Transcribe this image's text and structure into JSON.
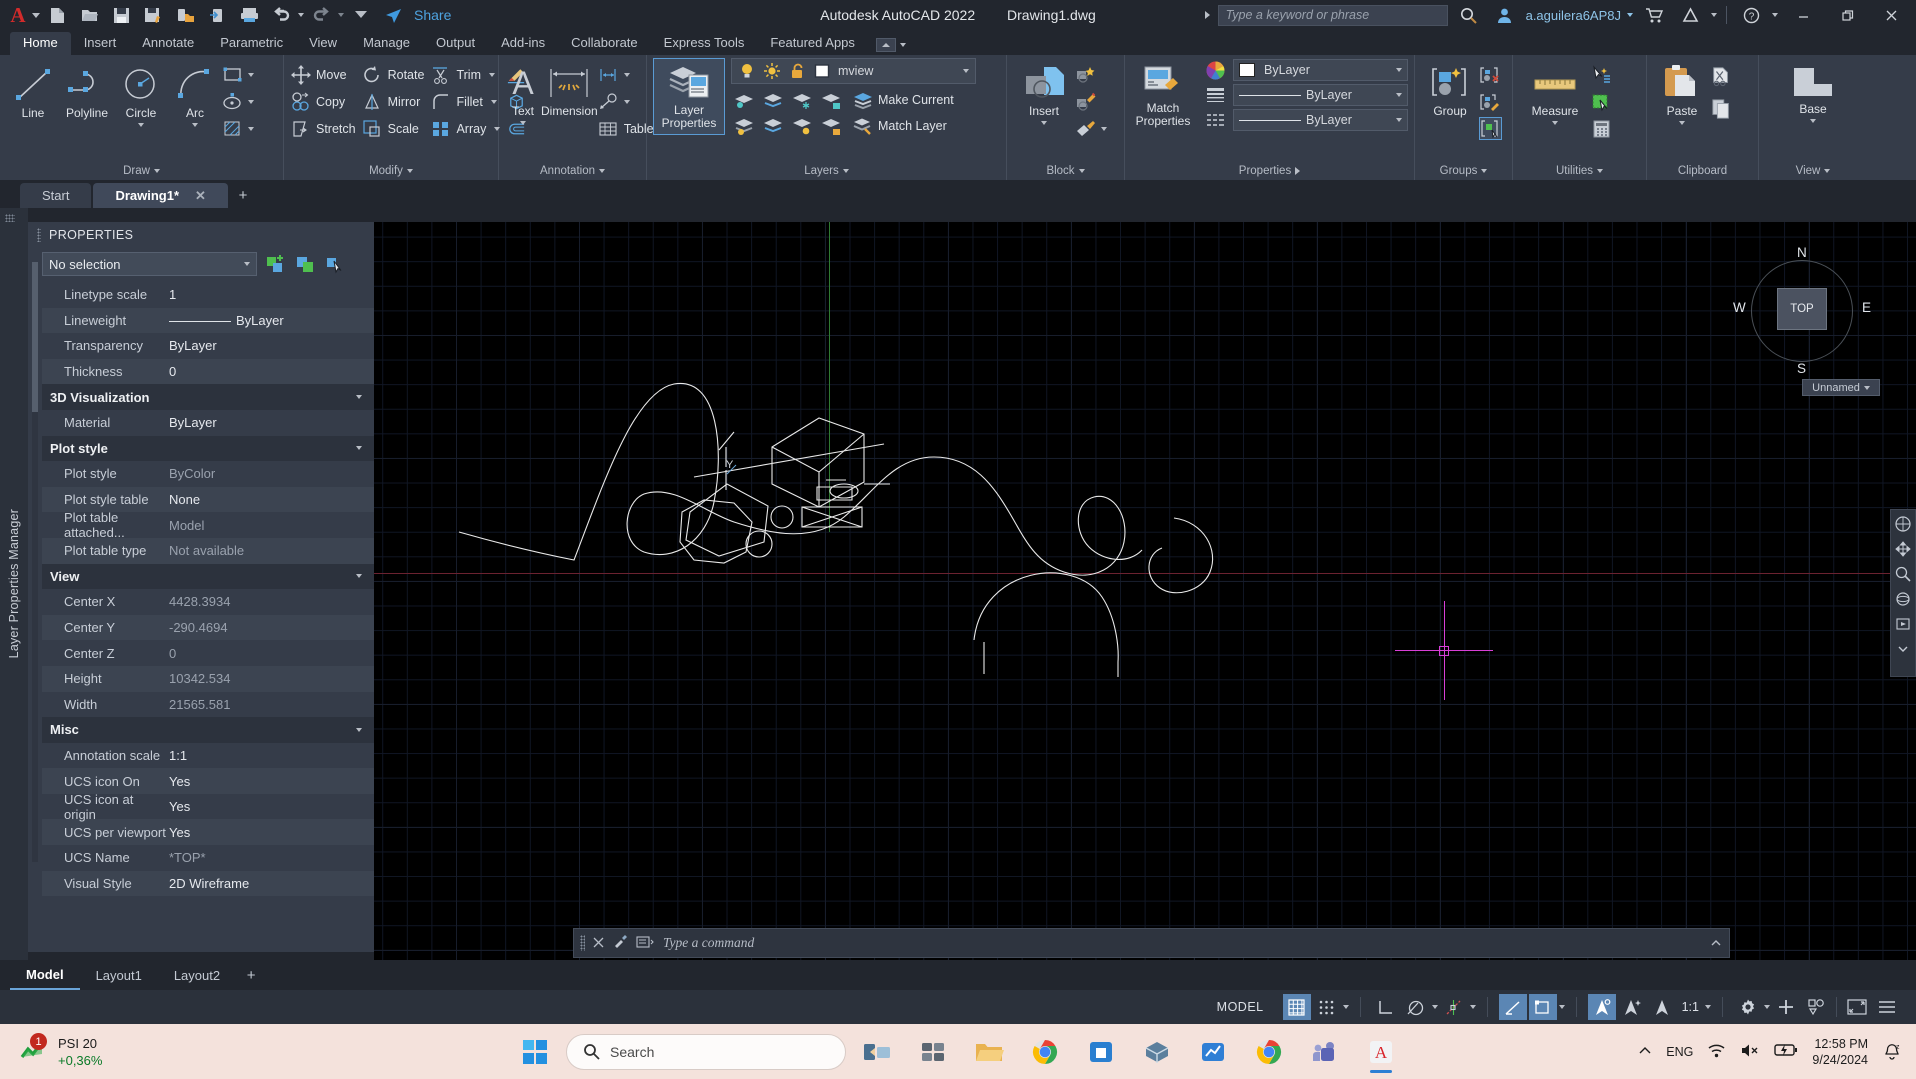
{
  "titlebar": {
    "app_icon": "autocad-a-icon",
    "quick_access": [
      {
        "name": "new-file-icon",
        "label": "New"
      },
      {
        "name": "open-folder-icon",
        "label": "Open"
      },
      {
        "name": "save-icon",
        "label": "Save"
      },
      {
        "name": "save-as-icon",
        "label": "Save As"
      },
      {
        "name": "save-to-web-icon",
        "label": "Save to Web & Mobile"
      },
      {
        "name": "open-from-web-icon",
        "label": "Open from Web & Mobile"
      },
      {
        "name": "plot-icon",
        "label": "Plot"
      },
      {
        "name": "undo-icon",
        "label": "Undo"
      },
      {
        "name": "redo-icon",
        "label": "Redo"
      }
    ],
    "share_label": "Share",
    "product": "Autodesk AutoCAD 2022",
    "document": "Drawing1.dwg",
    "search_placeholder": "Type a keyword or phrase",
    "account": "a.aguilera6AP8J",
    "window_controls": [
      "minimize",
      "restore",
      "close"
    ]
  },
  "ribbon_tabs": [
    {
      "label": "Home",
      "active": true
    },
    {
      "label": "Insert",
      "active": false
    },
    {
      "label": "Annotate",
      "active": false
    },
    {
      "label": "Parametric",
      "active": false
    },
    {
      "label": "View",
      "active": false
    },
    {
      "label": "Manage",
      "active": false
    },
    {
      "label": "Output",
      "active": false
    },
    {
      "label": "Add-ins",
      "active": false
    },
    {
      "label": "Collaborate",
      "active": false
    },
    {
      "label": "Express Tools",
      "active": false
    },
    {
      "label": "Featured Apps",
      "active": false
    }
  ],
  "ribbon": {
    "draw": {
      "title": "Draw",
      "big": [
        {
          "label": "Line",
          "icon": "line-icon"
        },
        {
          "label": "Polyline",
          "icon": "polyline-icon"
        },
        {
          "label": "Circle",
          "icon": "circle-icon",
          "has_dropdown": true
        },
        {
          "label": "Arc",
          "icon": "arc-icon",
          "has_dropdown": true
        }
      ],
      "small": [
        {
          "icon": "rectangle-icon",
          "label": "Rectangle"
        },
        {
          "icon": "ellipse-icon",
          "label": "Ellipse"
        },
        {
          "icon": "hatch-icon",
          "label": "Hatch"
        }
      ]
    },
    "modify": {
      "title": "Modify",
      "items": [
        {
          "label": "Move",
          "icon": "move-icon"
        },
        {
          "label": "Rotate",
          "icon": "rotate-icon"
        },
        {
          "label": "Trim",
          "icon": "trim-icon",
          "has_dropdown": true
        },
        {
          "label": "Copy",
          "icon": "copy-icon"
        },
        {
          "label": "Mirror",
          "icon": "mirror-icon"
        },
        {
          "label": "Fillet",
          "icon": "fillet-icon",
          "has_dropdown": true
        },
        {
          "label": "Stretch",
          "icon": "stretch-icon"
        },
        {
          "label": "Scale",
          "icon": "scale-icon"
        },
        {
          "label": "Array",
          "icon": "array-icon",
          "has_dropdown": true
        }
      ],
      "extra_icons": [
        "erase-icon",
        "explode-icon",
        "offset-icon"
      ]
    },
    "annotation": {
      "title": "Annotation",
      "big": [
        {
          "label": "Text",
          "icon": "text-icon",
          "has_dropdown": true
        },
        {
          "label": "Dimension",
          "icon": "dimension-icon"
        }
      ],
      "small": [
        {
          "icon": "linear-dim-icon",
          "label": "Linear"
        },
        {
          "icon": "leader-icon",
          "label": "Leader"
        },
        {
          "icon": "table-icon",
          "label": "Table"
        }
      ]
    },
    "layers": {
      "title": "Layers",
      "big_label": "Layer\nProperties",
      "big_label_line1": "Layer",
      "big_label_line2": "Properties",
      "current_layer": "mview",
      "make_current": "Make Current",
      "match_layer": "Match Layer",
      "state_icons": [
        "lightbulb-on-icon",
        "sun-freeze-icon",
        "unlock-icon",
        "layer-color-swatch"
      ]
    },
    "block": {
      "title": "Block",
      "big_label": "Insert",
      "small": [
        "create-block-icon",
        "edit-block-icon",
        "edit-attribute-icon"
      ]
    },
    "properties": {
      "title": "Properties",
      "match_label_line1": "Match",
      "match_label_line2": "Properties",
      "color": "ByLayer",
      "linetype": "ByLayer",
      "lineweight": "ByLayer"
    },
    "groups": {
      "title": "Groups",
      "big_label": "Group",
      "small": [
        "ungroup-icon",
        "edit-group-icon",
        "group-selection-icon"
      ]
    },
    "utilities": {
      "title": "Utilities",
      "big_label": "Measure",
      "small": [
        "quick-select-icon",
        "select-all-icon",
        "calculator-icon"
      ]
    },
    "clipboard": {
      "title": "Clipboard",
      "big_label": "Paste",
      "small": [
        "cut-icon",
        "copy-clip-icon"
      ]
    },
    "view": {
      "title": "View",
      "big_label": "Base"
    }
  },
  "file_tabs": [
    {
      "label": "Start",
      "active": false,
      "closable": false
    },
    {
      "label": "Drawing1*",
      "active": true,
      "closable": true
    }
  ],
  "file_tab_add": "+",
  "left_rail": {
    "label": "Layer Properties Manager"
  },
  "properties_palette": {
    "title": "PROPERTIES",
    "selection": "No selection",
    "toolbar_icons": [
      "quick-select-icon",
      "select-objects-icon",
      "pickadd-icon"
    ],
    "groups": [
      {
        "name": "",
        "is_header": false,
        "rows": [
          {
            "key": "Linetype scale",
            "value": "1",
            "dim": false
          },
          {
            "key": "Lineweight",
            "value": "ByLayer",
            "dim": false,
            "has_line": true
          },
          {
            "key": "Transparency",
            "value": "ByLayer",
            "dim": false
          },
          {
            "key": "Thickness",
            "value": "0",
            "dim": false
          }
        ]
      },
      {
        "name": "3D Visualization",
        "is_header": true,
        "rows": [
          {
            "key": "Material",
            "value": "ByLayer",
            "dim": false
          }
        ]
      },
      {
        "name": "Plot style",
        "is_header": true,
        "rows": [
          {
            "key": "Plot style",
            "value": "ByColor",
            "dim": true
          },
          {
            "key": "Plot style table",
            "value": "None",
            "dim": false
          },
          {
            "key": "Plot table attached...",
            "value": "Model",
            "dim": true
          },
          {
            "key": "Plot table type",
            "value": "Not available",
            "dim": true
          }
        ]
      },
      {
        "name": "View",
        "is_header": true,
        "rows": [
          {
            "key": "Center X",
            "value": "4428.3934",
            "dim": true
          },
          {
            "key": "Center Y",
            "value": "-290.4694",
            "dim": true
          },
          {
            "key": "Center Z",
            "value": "0",
            "dim": true
          },
          {
            "key": "Height",
            "value": "10342.534",
            "dim": true
          },
          {
            "key": "Width",
            "value": "21565.581",
            "dim": true
          }
        ]
      },
      {
        "name": "Misc",
        "is_header": true,
        "rows": [
          {
            "key": "Annotation scale",
            "value": "1:1",
            "dim": false
          },
          {
            "key": "UCS icon On",
            "value": "Yes",
            "dim": false
          },
          {
            "key": "UCS icon at origin",
            "value": "Yes",
            "dim": false
          },
          {
            "key": "UCS per viewport",
            "value": "Yes",
            "dim": false
          },
          {
            "key": "UCS Name",
            "value": "*TOP*",
            "dim": true
          },
          {
            "key": "Visual Style",
            "value": "2D Wireframe",
            "dim": false
          }
        ]
      }
    ]
  },
  "canvas": {
    "viewcube": {
      "top_label": "TOP",
      "north": "N",
      "south": "S",
      "east": "E",
      "west": "W"
    },
    "ucs_label": "Unnamed",
    "ucs_axis_y": "Y",
    "navbar_icons": [
      "pan-icon",
      "zoom-icon",
      "orbit-icon",
      "showmotion-icon",
      "steering-wheel-icon"
    ],
    "window_controls": [
      "minimize",
      "maximize",
      "close"
    ]
  },
  "command_line": {
    "placeholder": "Type a command",
    "icons": [
      "command-grip",
      "close-icon",
      "customize-icon",
      "command-history-icon"
    ]
  },
  "layout_tabs": [
    {
      "label": "Model",
      "active": true
    },
    {
      "label": "Layout1",
      "active": false
    },
    {
      "label": "Layout2",
      "active": false
    }
  ],
  "layout_tab_add": "+",
  "status_bar": {
    "space_label": "MODEL",
    "buttons": [
      {
        "name": "grid-display-toggle",
        "icon": "grid-icon",
        "on": true
      },
      {
        "name": "snap-mode-toggle",
        "icon": "snap-dots-icon",
        "on": false,
        "has_dropdown": true
      },
      {
        "name": "ortho-mode-toggle",
        "icon": "ortho-icon",
        "on": false
      },
      {
        "name": "polar-tracking-toggle",
        "icon": "polar-icon",
        "on": false,
        "has_dropdown": true
      },
      {
        "name": "object-snap-toggle",
        "icon": "osnap-icon",
        "on": false,
        "has_dropdown": true
      },
      {
        "name": "object-snap-tracking-toggle",
        "icon": "otrack-icon",
        "on": true
      },
      {
        "name": "dynamic-ucs-toggle",
        "icon": "dynamic-ucs-icon",
        "on": true,
        "has_dropdown": true
      },
      {
        "name": "annotation-visibility-toggle",
        "icon": "annotation-vis-icon",
        "on": true
      },
      {
        "name": "autoscale-toggle",
        "icon": "autoscale-icon",
        "on": false
      },
      {
        "name": "annotation-scale-icon",
        "icon": "annoscale-icon",
        "on": false
      }
    ],
    "annotation_scale": "1:1",
    "right_buttons": [
      {
        "name": "workspace-settings-button",
        "icon": "gear-icon",
        "has_dropdown": true
      },
      {
        "name": "customization-button",
        "icon": "plus-icon"
      },
      {
        "name": "isolate-objects-button",
        "icon": "isolate-icon"
      },
      {
        "name": "fullscreen-button",
        "icon": "fullscreen-icon"
      },
      {
        "name": "hamburger-button",
        "icon": "hamburger-icon"
      }
    ]
  },
  "taskbar": {
    "weather_widget": {
      "name": "PSI 20",
      "change": "+0,36%",
      "badge": "1"
    },
    "search_placeholder": "Search",
    "apps": [
      {
        "name": "taskview-icon",
        "label": "Task View"
      },
      {
        "name": "widgets-icon",
        "label": "Widgets"
      },
      {
        "name": "file-explorer-icon",
        "label": "File Explorer"
      },
      {
        "name": "chrome-icon",
        "label": "Google Chrome"
      },
      {
        "name": "store-icon",
        "label": "Microsoft Store"
      },
      {
        "name": "package-icon",
        "label": "App"
      },
      {
        "name": "chart-app-icon",
        "label": "Chart App"
      },
      {
        "name": "chrome2-icon",
        "label": "Chrome"
      },
      {
        "name": "teams-icon",
        "label": "Teams"
      },
      {
        "name": "autocad-icon",
        "label": "AutoCAD",
        "active": true
      }
    ],
    "tray": {
      "chevron": "show-hidden-icons",
      "language": "ENG",
      "wifi": "wifi-icon",
      "volume": "volume-muted-icon",
      "battery": "battery-charging-icon",
      "time": "12:58 PM",
      "date": "9/24/2024",
      "notifications": "notification-bell-icon"
    }
  },
  "colors": {
    "titlebar_bg": "#22262e",
    "ribbon_bg": "#353c49",
    "canvas_bg": "#000000",
    "accent_blue": "#5b86b4",
    "link_blue": "#4ea3e0",
    "taskbar_bg": "#f4e2dc",
    "magenta_cursor": "#d73fd7",
    "green_axis": "#2f7a33",
    "red_axis": "#6b2230"
  }
}
